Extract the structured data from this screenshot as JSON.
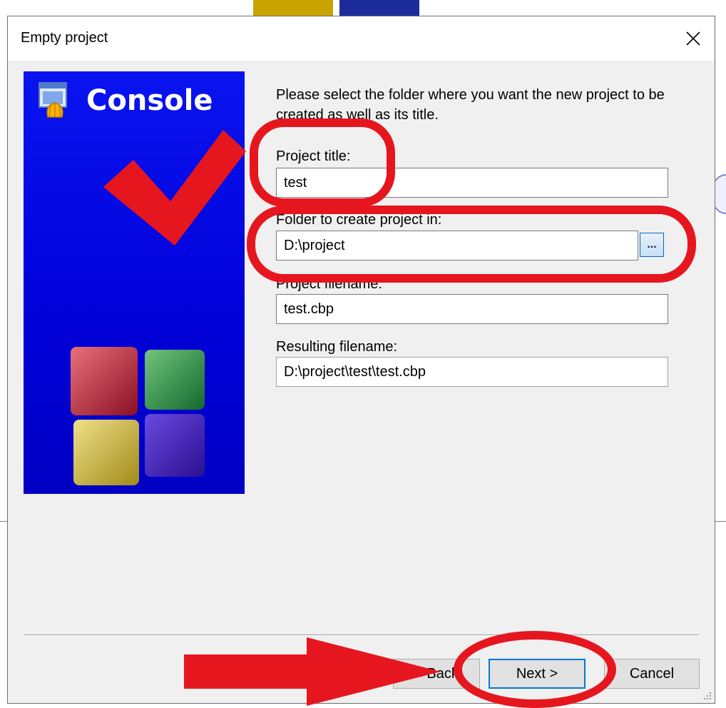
{
  "dialog": {
    "title": "Empty project",
    "banner_title": "Console",
    "description": "Please select the folder where you want the new project to be created as well as its title.",
    "fields": {
      "project_title_label": "Project title:",
      "project_title_value": "test",
      "folder_label": "Folder to create project in:",
      "folder_value": "D:\\project",
      "browse_label": "...",
      "filename_label": "Project filename:",
      "filename_value": "test.cbp",
      "resulting_label": "Resulting filename:",
      "resulting_value": "D:\\project\\test\\test.cbp"
    },
    "buttons": {
      "back": "< Back",
      "next": "Next >",
      "cancel": "Cancel"
    }
  },
  "icons": [
    "close-icon",
    "console-app-icon",
    "checkmark-icon",
    "cubes-logo-icon",
    "resize-grip-icon",
    "arrow-annotation-icon"
  ],
  "colors": {
    "banner_blue": "#0000d8",
    "annotation_red": "#e6161f",
    "dialog_bg": "#f0f0f0",
    "focus_blue": "#0078d7"
  }
}
